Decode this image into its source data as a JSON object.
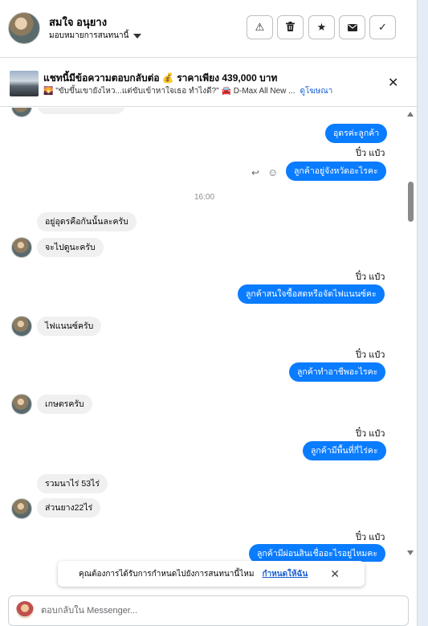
{
  "header": {
    "contact_name": "สมใจ อนุยาง",
    "assign_label": "มอบหมายการสนทนานี้",
    "buttons": [
      {
        "name": "mark-spam-button",
        "icon": "warning-icon",
        "glyph": "⚠"
      },
      {
        "name": "delete-button",
        "icon": "trash-icon",
        "glyph": "🗑"
      },
      {
        "name": "star-button",
        "icon": "star-icon",
        "glyph": "★"
      },
      {
        "name": "mark-unread-button",
        "icon": "envelope-icon",
        "glyph": "✉"
      },
      {
        "name": "mark-done-button",
        "icon": "check-icon",
        "glyph": "✓"
      }
    ]
  },
  "ad_bar": {
    "title": "แชทนี้มีข้อความตอบกลับต่อ 💰 ราคาเพียง 439,000 บาท",
    "subtitle": "🌄 \"ขับขึ้นเขายังไหว...แต่ขับเข้าหาใจเธอ ทำไงดี?\" 🚘 D-Max All New ...",
    "view_ad_label": "ดูโฆษณา"
  },
  "messages": [
    {
      "side": "out",
      "text": "อุดรค่ะลูกค้า"
    },
    {
      "type": "seen",
      "text": "ปิ๋ว แป๋ว"
    },
    {
      "side": "out",
      "text": "ลูกค้าอยู่จังหวัดอะไรคะ"
    },
    {
      "type": "timestamp",
      "text": "16:00"
    },
    {
      "side": "in",
      "text": "อยู่อุดรคือกันนั้นละครับ"
    },
    {
      "side": "in",
      "text": "จะไปดูนะครับ"
    },
    {
      "type": "seen",
      "text": "ปิ๋ว แป๋ว"
    },
    {
      "side": "out",
      "text": "ลูกค้าสนใจซื้อสดหรือจัดไฟแนนซ์คะ"
    },
    {
      "side": "in",
      "text": "ไฟแนนซ์ครับ"
    },
    {
      "type": "seen",
      "text": "ปิ๋ว แป๋ว"
    },
    {
      "side": "out",
      "text": "ลูกค้าทำอาชีพอะไรคะ"
    },
    {
      "side": "in",
      "text": "เกษตรครับ"
    },
    {
      "type": "seen",
      "text": "ปิ๋ว แป๋ว"
    },
    {
      "side": "out",
      "text": "ลูกค้ามีพื้นที่กี่ไร่คะ"
    },
    {
      "side": "in",
      "text": "รวมนาไร่ 53ไร่"
    },
    {
      "side": "in",
      "text": "ส่วนยาง22ไร่"
    },
    {
      "type": "seen",
      "text": "ปิ๋ว แป๋ว"
    },
    {
      "side": "out",
      "text": "ลูกค้ามีผ่อนสินเชื่ออะไรอยู่ไหมคะ"
    }
  ],
  "toast": {
    "text": "คุณต้องการได้รับการกำหนดไปยังการสนทนานี้ไหม",
    "action_label": "กำหนดให้ฉัน"
  },
  "composer": {
    "placeholder": "ตอบกลับใน Messenger..."
  },
  "colors": {
    "outgoing_bubble": "#0a7cff",
    "incoming_bubble": "#f0f0f0",
    "link": "#1a5fd0"
  }
}
